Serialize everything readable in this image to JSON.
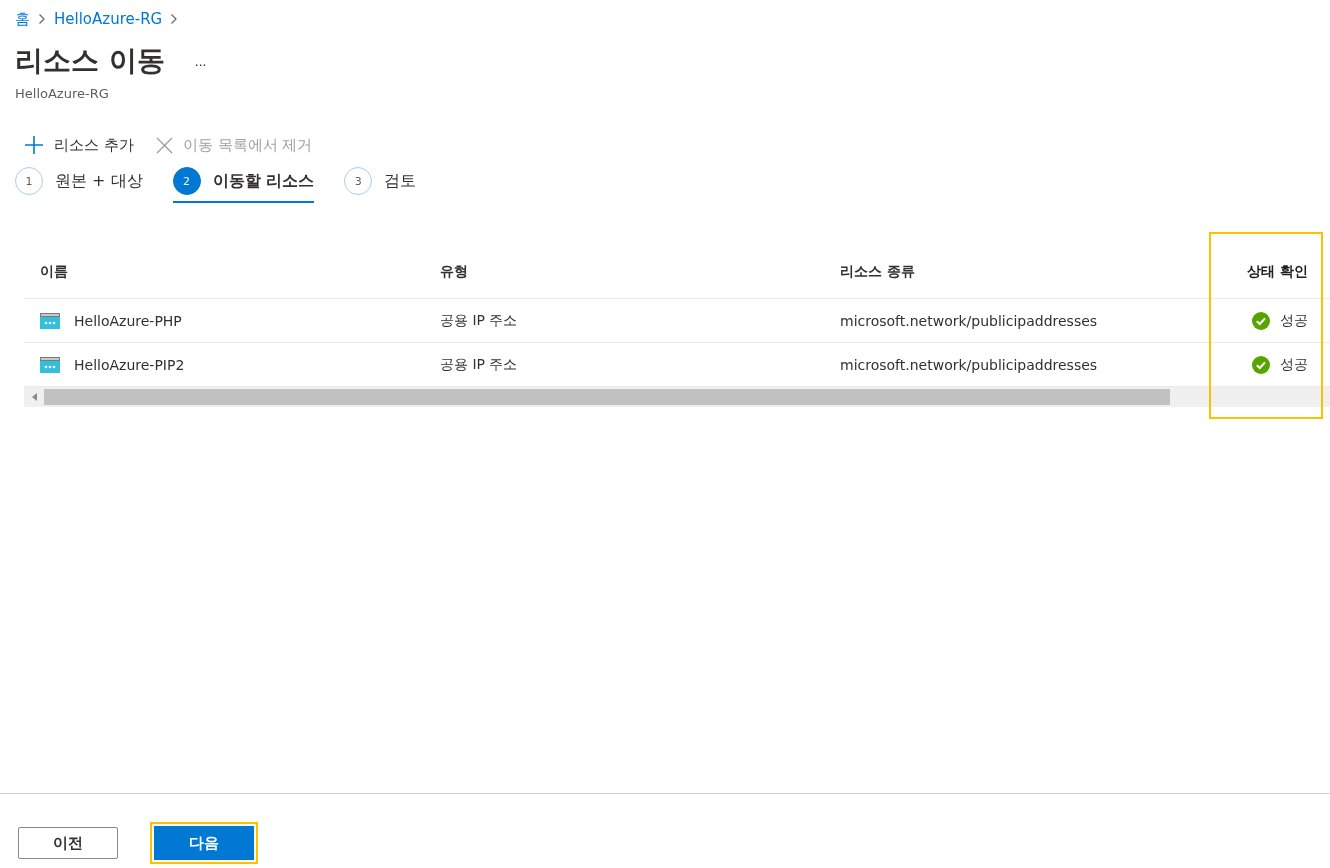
{
  "breadcrumb": [
    {
      "label": "홈"
    },
    {
      "label": "HelloAzure-RG"
    }
  ],
  "title": "리소스 이동",
  "more": "...",
  "subtitle": "HelloAzure-RG",
  "toolbar": [
    {
      "label": "리소스 추가",
      "kind": "add",
      "disabled": false
    },
    {
      "label": "이동 목록에서 제거",
      "kind": "remove",
      "disabled": true
    }
  ],
  "steps": [
    {
      "number": "1",
      "label": "원본 + 대상",
      "selected": false
    },
    {
      "number": "2",
      "label": "이동할 리소스",
      "selected": true
    },
    {
      "number": "3",
      "label": "검토",
      "selected": false
    }
  ],
  "table": {
    "columns": [
      {
        "label": "이름",
        "highlighted": false
      },
      {
        "label": "유형",
        "highlighted": false
      },
      {
        "label": "리소스 종류",
        "highlighted": false
      },
      {
        "label": "상태 확인",
        "highlighted": true
      }
    ],
    "rows": [
      {
        "name": "HelloAzure-PHP",
        "type": "공용 IP 주소",
        "resource_kind": "microsoft.network/publicipaddresses",
        "status": {
          "kind": "success",
          "text": "성공"
        }
      },
      {
        "name": "HelloAzure-PIP2",
        "type": "공용 IP 주소",
        "resource_kind": "microsoft.network/publicipaddresses",
        "status": {
          "kind": "success",
          "text": "성공"
        }
      }
    ]
  },
  "buttons": [
    {
      "label": "이전",
      "kind": "secondary",
      "highlighted": false
    },
    {
      "label": "다음",
      "kind": "primary",
      "highlighted": true
    }
  ]
}
